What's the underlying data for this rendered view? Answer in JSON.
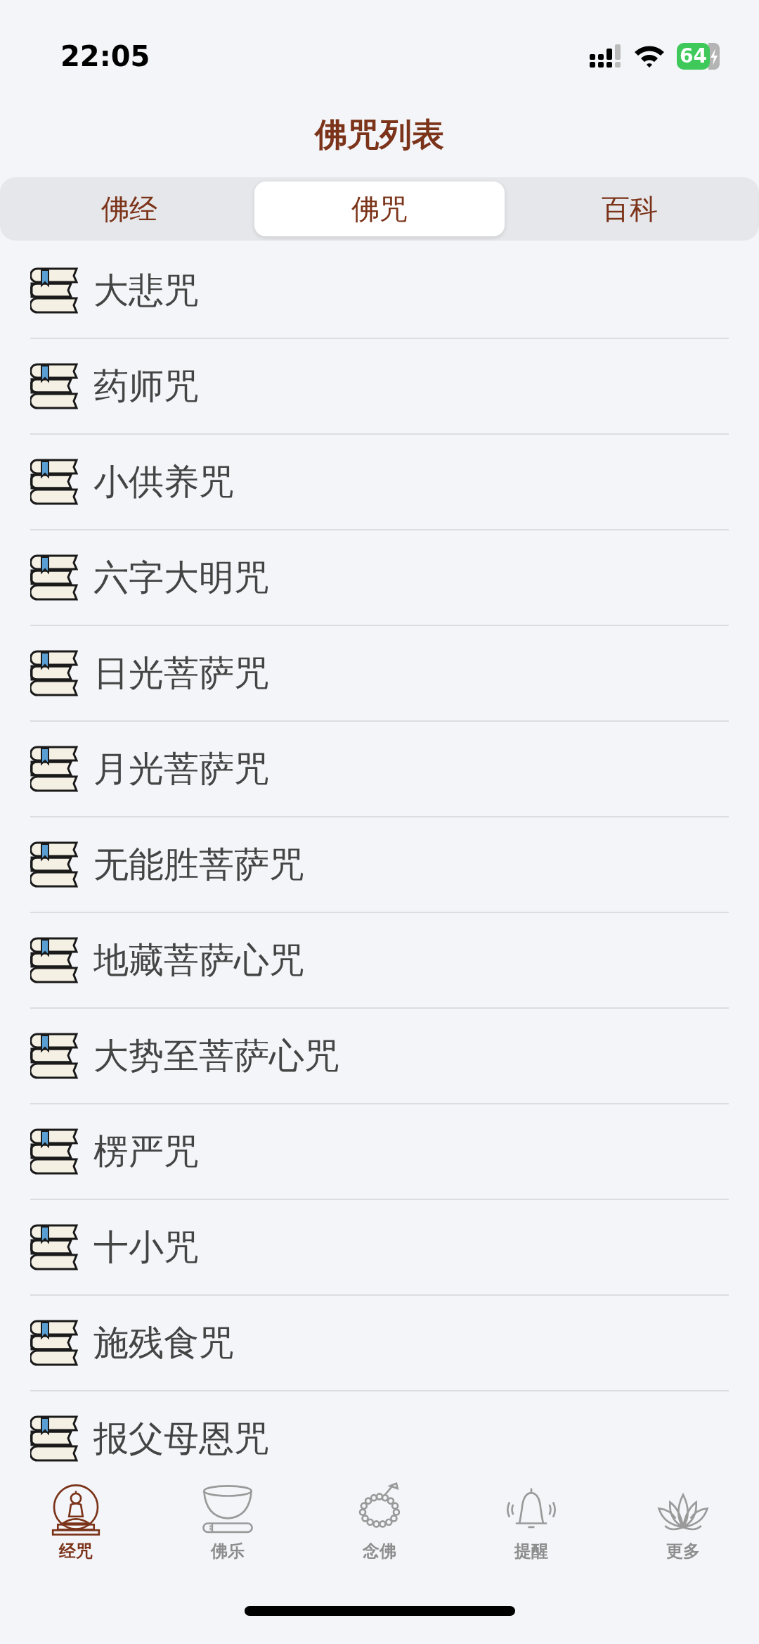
{
  "status_bar": {
    "time": "22:05",
    "battery": "64"
  },
  "title": "佛咒列表",
  "segments": [
    {
      "label": "佛经",
      "selected": false
    },
    {
      "label": "佛咒",
      "selected": true
    },
    {
      "label": "百科",
      "selected": false
    }
  ],
  "items": [
    "大悲咒",
    "药师咒",
    "小供养咒",
    "六字大明咒",
    "日光菩萨咒",
    "月光菩萨咒",
    "无能胜菩萨咒",
    "地藏菩萨心咒",
    "大势至菩萨心咒",
    "楞严咒",
    "十小咒",
    "施残食咒",
    "报父母恩咒"
  ],
  "tab_bar": [
    {
      "label": "经咒",
      "kind": "buddha",
      "selected": true
    },
    {
      "label": "佛乐",
      "kind": "bowl",
      "selected": false
    },
    {
      "label": "念佛",
      "kind": "beads",
      "selected": false
    },
    {
      "label": "提醒",
      "kind": "bell",
      "selected": false
    },
    {
      "label": "更多",
      "kind": "lotus",
      "selected": false
    }
  ]
}
